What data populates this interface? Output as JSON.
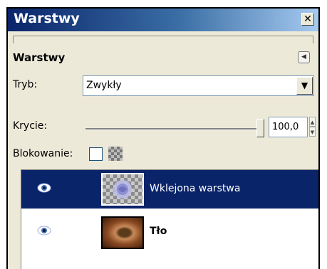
{
  "window": {
    "title": "Warstwy",
    "close_glyph": "✕"
  },
  "dock": {
    "title": "Warstwy",
    "menu_icon": "dock-menu-icon"
  },
  "mode": {
    "label": "Tryb:",
    "value": "Zwykły"
  },
  "opacity": {
    "label": "Krycie:",
    "value": "100,0",
    "fraction": 1.0
  },
  "lock": {
    "label": "Blokowanie:",
    "checked": false,
    "alpha_icon": "alpha-lock-icon"
  },
  "layers": [
    {
      "name": "Wklejona warstwa",
      "visible": true,
      "selected": true,
      "thumb": "rose-checkerboard"
    },
    {
      "name": "Tło",
      "visible": true,
      "selected": false,
      "thumb": "eye-photo"
    }
  ],
  "colors": {
    "selection": "#0a246a",
    "panel": "#ece9d8",
    "title_start": "#0a246a",
    "title_end": "#a6caf0"
  }
}
